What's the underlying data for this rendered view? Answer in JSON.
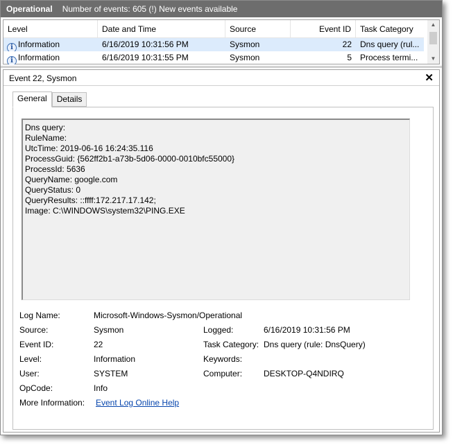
{
  "topbar": {
    "title": "Operational",
    "status": "Number of events: 605 (!) New events available"
  },
  "event_list": {
    "columns": [
      "Level",
      "Date and Time",
      "Source",
      "Event ID",
      "Task Category"
    ],
    "rows": [
      {
        "level": "Information",
        "datetime": "6/16/2019 10:31:56 PM",
        "source": "Sysmon",
        "event_id": "22",
        "task_category": "Dns query (rul...",
        "level_icon": "info-icon"
      },
      {
        "level": "Information",
        "datetime": "6/16/2019 10:31:55 PM",
        "source": "Sysmon",
        "event_id": "5",
        "task_category": "Process termi...",
        "level_icon": "info-icon"
      }
    ]
  },
  "detail": {
    "title": "Event 22, Sysmon",
    "close_glyph": "✕",
    "tabs": [
      "General",
      "Details"
    ],
    "description_lines": [
      "Dns query:",
      "RuleName:",
      "UtcTime: 2019-06-16 16:24:35.116",
      "ProcessGuid: {562ff2b1-a73b-5d06-0000-0010bfc55000}",
      "ProcessId: 5636",
      "QueryName: google.com",
      "QueryStatus: 0",
      "QueryResults: ::ffff:172.217.17.142;",
      "Image: C:\\WINDOWS\\system32\\PING.EXE"
    ],
    "fields": {
      "log_name_label": "Log Name:",
      "log_name": "Microsoft-Windows-Sysmon/Operational",
      "source_label": "Source:",
      "source": "Sysmon",
      "logged_label": "Logged:",
      "logged": "6/16/2019 10:31:56 PM",
      "event_id_label": "Event ID:",
      "event_id": "22",
      "task_category_label": "Task Category:",
      "task_category": "Dns query (rule: DnsQuery)",
      "level_label": "Level:",
      "level": "Information",
      "keywords_label": "Keywords:",
      "keywords": "",
      "user_label": "User:",
      "user": "SYSTEM",
      "computer_label": "Computer:",
      "computer": "DESKTOP-Q4NDIRQ",
      "opcode_label": "OpCode:",
      "opcode": "Info",
      "more_info_label": "More Information:",
      "more_info_link": "Event Log Online Help"
    }
  },
  "colors": {
    "topbar": "#6d6d6d",
    "selected_row": "#dcebfc",
    "link": "#0645ad"
  }
}
